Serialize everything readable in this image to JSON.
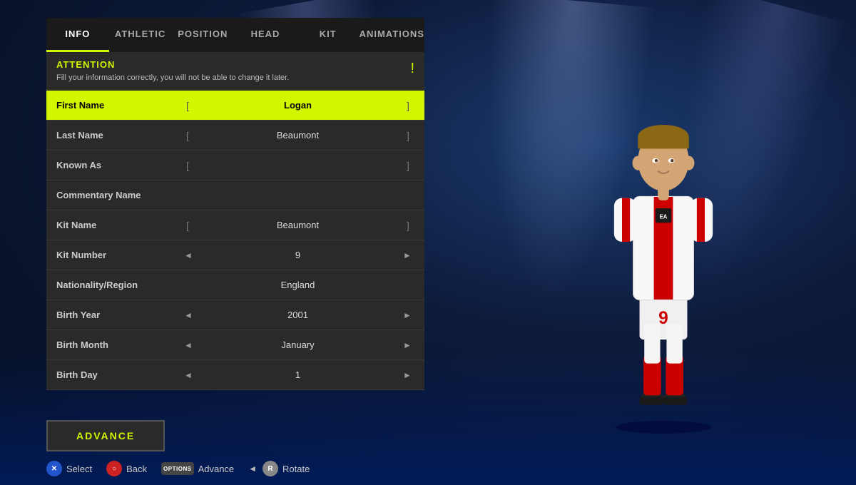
{
  "tabs": [
    {
      "id": "info",
      "label": "INFO",
      "active": true
    },
    {
      "id": "athletic",
      "label": "ATHLETIC",
      "active": false
    },
    {
      "id": "position",
      "label": "POSITION",
      "active": false
    },
    {
      "id": "head",
      "label": "HEAD",
      "active": false
    },
    {
      "id": "kit",
      "label": "KIT",
      "active": false
    },
    {
      "id": "animations",
      "label": "ANIMATIONS",
      "active": false
    }
  ],
  "attention": {
    "title": "ATTENTION",
    "text": "Fill your information correctly, you will not be able to\nchange it later.",
    "icon": "!"
  },
  "fields": [
    {
      "label": "First Name",
      "value": "Logan",
      "has_brackets": true,
      "has_arrows": false,
      "active": true
    },
    {
      "label": "Last Name",
      "value": "Beaumont",
      "has_brackets": true,
      "has_arrows": false,
      "active": false
    },
    {
      "label": "Known As",
      "value": "",
      "has_brackets": true,
      "has_arrows": false,
      "active": false
    },
    {
      "label": "Commentary Name",
      "value": "",
      "has_brackets": false,
      "has_arrows": false,
      "active": false
    },
    {
      "label": "Kit Name",
      "value": "Beaumont",
      "has_brackets": true,
      "has_arrows": false,
      "active": false
    },
    {
      "label": "Kit Number",
      "value": "9",
      "has_brackets": false,
      "has_arrows": true,
      "active": false
    },
    {
      "label": "Nationality/Region",
      "value": "England",
      "has_brackets": false,
      "has_arrows": false,
      "active": false
    },
    {
      "label": "Birth Year",
      "value": "2001",
      "has_brackets": false,
      "has_arrows": true,
      "active": false
    },
    {
      "label": "Birth Month",
      "value": "January",
      "has_brackets": false,
      "has_arrows": true,
      "active": false
    },
    {
      "label": "Birth Day",
      "value": "1",
      "has_brackets": false,
      "has_arrows": true,
      "active": false
    }
  ],
  "advance_button": "ADVANCE",
  "controls": [
    {
      "button": "X",
      "label": "Select",
      "style": "x"
    },
    {
      "button": "O",
      "label": "Back",
      "style": "o"
    },
    {
      "button": "OPTIONS",
      "label": "Advance",
      "style": "options"
    },
    {
      "button": "R",
      "label": "Rotate",
      "style": "r",
      "prefix": "◄"
    }
  ],
  "colors": {
    "accent": "#d4f500",
    "background_dark": "#1a1a1a",
    "panel_bg": "#2a2a2a",
    "active_row": "#d4f500"
  }
}
